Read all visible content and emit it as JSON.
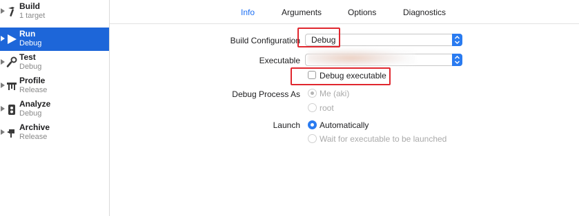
{
  "sidebar": {
    "items": [
      {
        "title": "Build",
        "subtitle": "1 target",
        "icon": "hammer-icon"
      },
      {
        "title": "Run",
        "subtitle": "Debug",
        "icon": "play-icon",
        "selected": true
      },
      {
        "title": "Test",
        "subtitle": "Debug",
        "icon": "wrench-icon"
      },
      {
        "title": "Profile",
        "subtitle": "Release",
        "icon": "gauge-icon"
      },
      {
        "title": "Analyze",
        "subtitle": "Debug",
        "icon": "analyze-icon"
      },
      {
        "title": "Archive",
        "subtitle": "Release",
        "icon": "archive-icon"
      }
    ]
  },
  "tabs": [
    {
      "label": "Info",
      "active": true
    },
    {
      "label": "Arguments"
    },
    {
      "label": "Options"
    },
    {
      "label": "Diagnostics"
    }
  ],
  "form": {
    "build_configuration": {
      "label": "Build Configuration",
      "value": "Debug"
    },
    "executable": {
      "label": "Executable",
      "value": ""
    },
    "debug_executable": {
      "label": "Debug executable",
      "checked": false
    },
    "debug_process_as": {
      "label": "Debug Process As",
      "options": [
        {
          "label": "Me (aki)",
          "selected": true,
          "disabled": true
        },
        {
          "label": "root",
          "selected": false,
          "disabled": true
        }
      ]
    },
    "launch": {
      "label": "Launch",
      "options": [
        {
          "label": "Automatically",
          "selected": true,
          "disabled": false
        },
        {
          "label": "Wait for executable to be launched",
          "selected": false,
          "disabled": true
        }
      ]
    }
  },
  "colors": {
    "accent": "#1b6ef3",
    "sidebar_selected": "#1d66d9",
    "highlight_annotation": "#e0262e"
  }
}
